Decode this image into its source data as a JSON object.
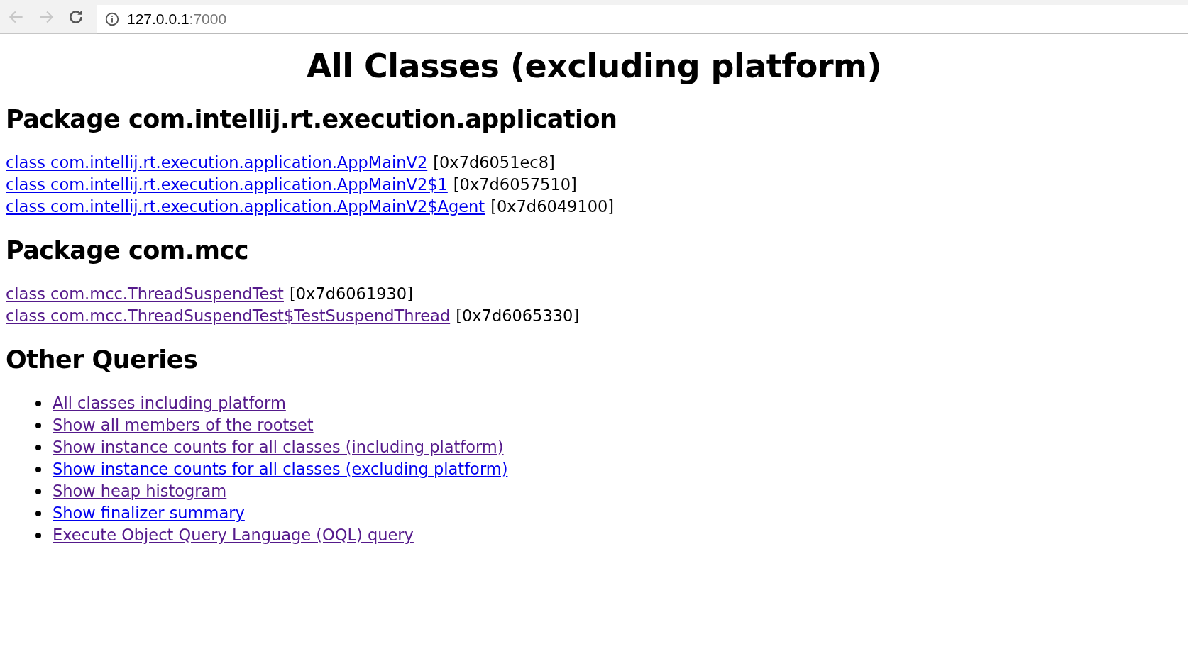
{
  "browser": {
    "address_host": "127.0.0.1",
    "address_port": ":7000"
  },
  "title": "All Classes (excluding platform)",
  "packages": [
    {
      "heading": "Package com.intellij.rt.execution.application",
      "classes": [
        {
          "link": "class com.intellij.rt.execution.application.AppMainV2",
          "visited": false,
          "address": "[0x7d6051ec8]"
        },
        {
          "link": "class com.intellij.rt.execution.application.AppMainV2$1",
          "visited": false,
          "address": "[0x7d6057510]"
        },
        {
          "link": "class com.intellij.rt.execution.application.AppMainV2$Agent",
          "visited": false,
          "address": "[0x7d6049100]"
        }
      ]
    },
    {
      "heading": "Package com.mcc",
      "classes": [
        {
          "link": "class com.mcc.ThreadSuspendTest",
          "visited": true,
          "address": "[0x7d6061930]"
        },
        {
          "link": "class com.mcc.ThreadSuspendTest$TestSuspendThread",
          "visited": true,
          "address": "[0x7d6065330]"
        }
      ]
    }
  ],
  "other_queries": {
    "heading": "Other Queries",
    "links": [
      {
        "label": "All classes including platform",
        "visited": true
      },
      {
        "label": "Show all members of the rootset",
        "visited": true
      },
      {
        "label": "Show instance counts for all classes (including platform)",
        "visited": true
      },
      {
        "label": "Show instance counts for all classes (excluding platform)",
        "visited": false
      },
      {
        "label": "Show heap histogram",
        "visited": true
      },
      {
        "label": "Show finalizer summary",
        "visited": false
      },
      {
        "label": "Execute Object Query Language (OQL) query",
        "visited": true
      }
    ]
  }
}
